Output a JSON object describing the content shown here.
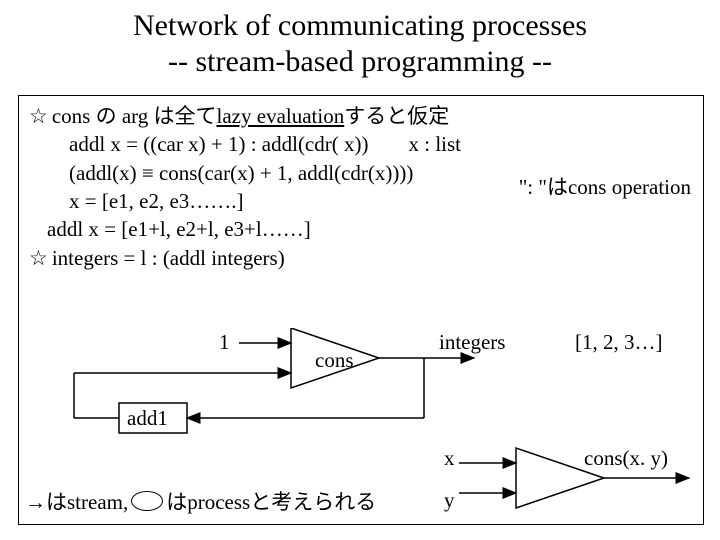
{
  "title_l1": "Network of communicating processes",
  "title_l2": "-- stream-based programming --",
  "text": {
    "star": "☆",
    "line1a": "cons の arg は全て ",
    "line1b": "lazy evaluation",
    "line1c": " すると仮定",
    "line2a": "addl x = ((car x) + 1) : addl(cdr( x))",
    "line2b": "x : list",
    "line3": "(addl(x) ≡ cons(car(x) + 1, addl(cdr(x))))",
    "note": "\": \"はcons operation",
    "line4": "x = [e1, e2, e3…….]",
    "line5": "addl x = [e1+l, e2+l, e3+l……]",
    "line6": "integers = l : (addl integers)"
  },
  "diagram": {
    "one": "1",
    "cons": "cons",
    "integers": "integers",
    "list": "[1, 2, 3…]",
    "add1": "add1",
    "x": "x",
    "y": "y",
    "consxy": "cons(x. y)"
  },
  "footer": {
    "a": "→はstream, ",
    "b": "はprocessと考えられる"
  }
}
